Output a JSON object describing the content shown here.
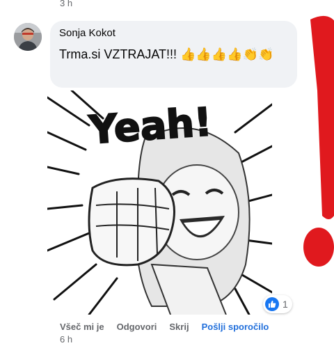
{
  "previous_comment": {
    "time": "3 h"
  },
  "comment": {
    "author": "Sonja Kokot",
    "text": "Trma.si VZTRAJAT!!! 👍👍👍👍👏👏",
    "sticker_text": "Yeah!",
    "reactions": {
      "icon": "like-icon",
      "count": "1"
    },
    "actions": {
      "like": "Všeč mi je",
      "reply": "Odgovori",
      "hide": "Skrij",
      "message": "Pošlji sporočilo"
    },
    "time": "6 h"
  },
  "colors": {
    "bubble": "#f0f2f5",
    "link_blue": "#216fdb",
    "like_blue": "#1877f2",
    "meta_gray": "#65676b",
    "annotation_red": "#e0191e"
  }
}
